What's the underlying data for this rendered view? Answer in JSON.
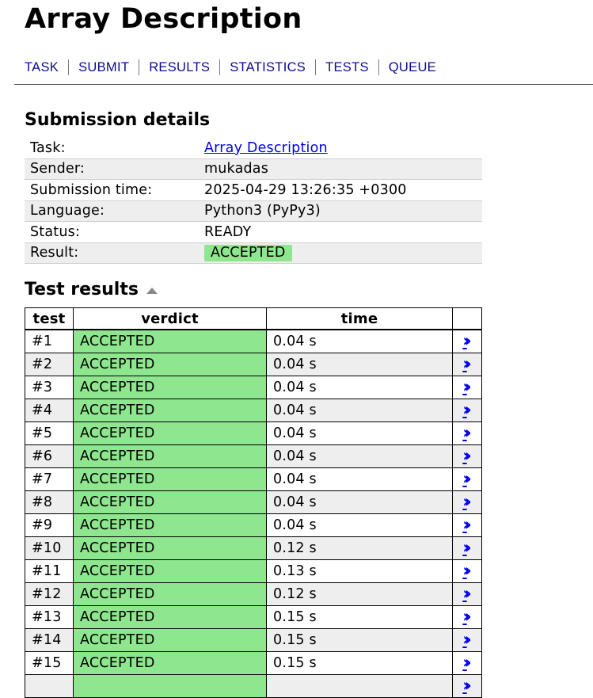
{
  "page": {
    "title": "Array Description"
  },
  "nav": [
    "TASK",
    "SUBMIT",
    "RESULTS",
    "STATISTICS",
    "TESTS",
    "QUEUE"
  ],
  "details": {
    "heading": "Submission details",
    "task_label": "Task:",
    "task_value": "Array Description",
    "sender_label": "Sender:",
    "sender_value": "mukadas",
    "time_label": "Submission time:",
    "time_value": "2025-04-29 13:26:35 +0300",
    "language_label": "Language:",
    "language_value": "Python3 (PyPy3)",
    "status_label": "Status:",
    "status_value": "READY",
    "result_label": "Result:",
    "result_value": "ACCEPTED"
  },
  "tests": {
    "heading": "Test results",
    "columns": {
      "test": "test",
      "verdict": "verdict",
      "time": "time"
    },
    "rows": [
      {
        "id": "#1",
        "verdict": "ACCEPTED",
        "time": "0.04 s"
      },
      {
        "id": "#2",
        "verdict": "ACCEPTED",
        "time": "0.04 s"
      },
      {
        "id": "#3",
        "verdict": "ACCEPTED",
        "time": "0.04 s"
      },
      {
        "id": "#4",
        "verdict": "ACCEPTED",
        "time": "0.04 s"
      },
      {
        "id": "#5",
        "verdict": "ACCEPTED",
        "time": "0.04 s"
      },
      {
        "id": "#6",
        "verdict": "ACCEPTED",
        "time": "0.04 s"
      },
      {
        "id": "#7",
        "verdict": "ACCEPTED",
        "time": "0.04 s"
      },
      {
        "id": "#8",
        "verdict": "ACCEPTED",
        "time": "0.04 s"
      },
      {
        "id": "#9",
        "verdict": "ACCEPTED",
        "time": "0.04 s"
      },
      {
        "id": "#10",
        "verdict": "ACCEPTED",
        "time": "0.12 s"
      },
      {
        "id": "#11",
        "verdict": "ACCEPTED",
        "time": "0.13 s"
      },
      {
        "id": "#12",
        "verdict": "ACCEPTED",
        "time": "0.12 s"
      },
      {
        "id": "#13",
        "verdict": "ACCEPTED",
        "time": "0.15 s"
      },
      {
        "id": "#14",
        "verdict": "ACCEPTED",
        "time": "0.15 s"
      },
      {
        "id": "#15",
        "verdict": "ACCEPTED",
        "time": "0.15 s"
      },
      {
        "id": "",
        "verdict": "",
        "time": ""
      }
    ]
  },
  "colors": {
    "accepted": "#8ee68e",
    "link": "#0000ee",
    "nav": "#0b0b8c"
  }
}
